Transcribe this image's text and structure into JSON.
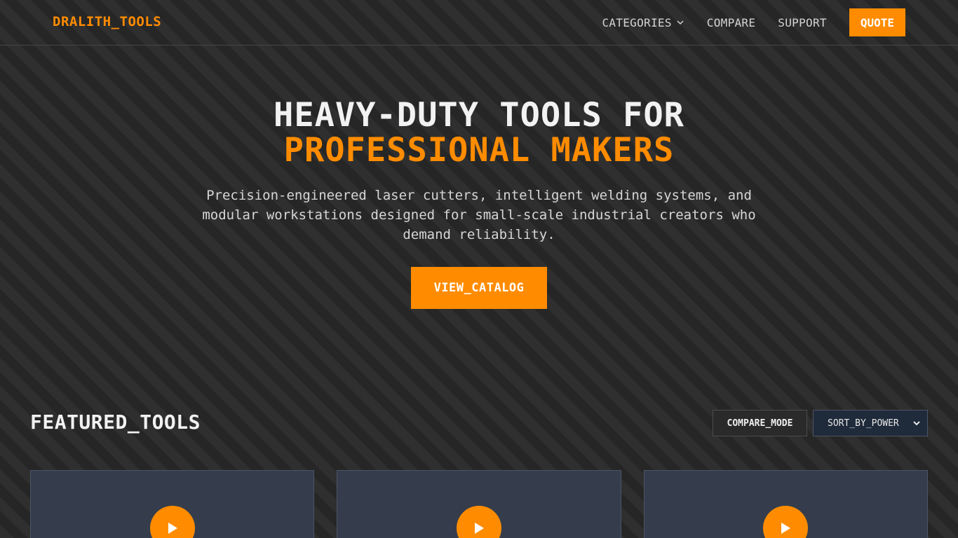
{
  "header": {
    "logo": "DRALITH_TOOLS",
    "nav": [
      {
        "label": "CATEGORIES",
        "has_dropdown": true
      },
      {
        "label": "COMPARE"
      },
      {
        "label": "SUPPORT"
      }
    ],
    "quote_label": "QUOTE"
  },
  "hero": {
    "title_line1": "HEAVY-DUTY TOOLS FOR",
    "title_line2": "PROFESSIONAL MAKERS",
    "subtitle": "Precision-engineered laser cutters, intelligent welding systems, and modular workstations designed for small-scale industrial creators who demand reliability.",
    "cta_label": "VIEW_CATALOG"
  },
  "featured": {
    "title": "FEATURED_TOOLS",
    "compare_mode_label": "COMPARE_MODE",
    "sort_selected": "SORT_BY_POWER",
    "cards_count": 3
  },
  "colors": {
    "accent": "#ff8c00",
    "card_bg": "#353d4c",
    "select_bg": "#1f2a3a"
  },
  "icons": [
    "chevron-down-icon",
    "play-icon"
  ]
}
